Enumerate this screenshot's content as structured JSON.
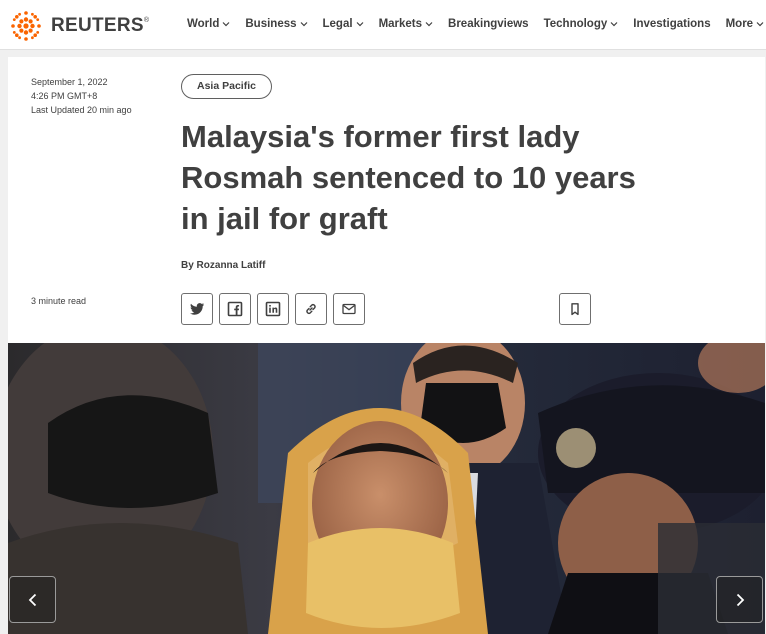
{
  "brand": {
    "name": "REUTERS",
    "mark": "®",
    "color": "#fa6400"
  },
  "nav": {
    "items": [
      {
        "label": "World",
        "dropdown": true
      },
      {
        "label": "Business",
        "dropdown": true
      },
      {
        "label": "Legal",
        "dropdown": true
      },
      {
        "label": "Markets",
        "dropdown": true
      },
      {
        "label": "Breakingviews",
        "dropdown": false
      },
      {
        "label": "Technology",
        "dropdown": true
      },
      {
        "label": "Investigations",
        "dropdown": false
      },
      {
        "label": "More",
        "dropdown": true
      }
    ]
  },
  "article": {
    "date": "September 1, 2022",
    "time": "4:26 PM GMT+8",
    "updated": "Last Updated 20 min ago",
    "read_time": "3 minute read",
    "section_tag": "Asia Pacific",
    "headline_lines": [
      "Malaysia's former first lady",
      "Rosmah sentenced to 10 years",
      "in jail for graft"
    ],
    "byline": "By Rozanna Latiff"
  },
  "share": {
    "icons": [
      "twitter-icon",
      "facebook-icon",
      "linkedin-icon",
      "link-icon",
      "email-icon"
    ],
    "bookmark_icon": "bookmark-icon"
  },
  "gallery": {
    "prev_icon": "chevron-left-icon",
    "next_icon": "chevron-right-icon"
  }
}
